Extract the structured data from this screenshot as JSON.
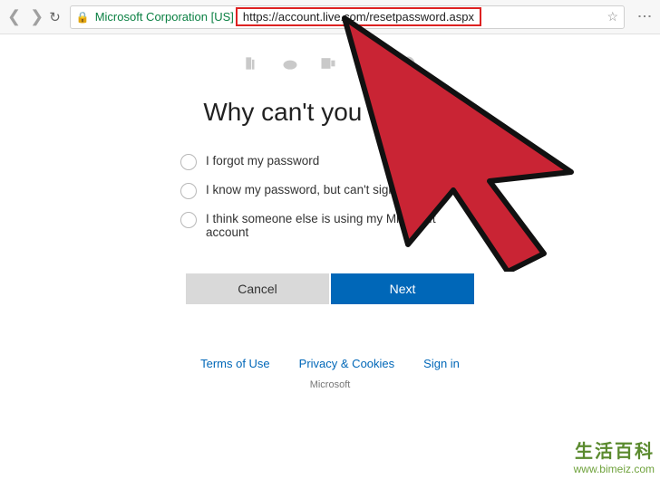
{
  "chrome": {
    "org_label": "Microsoft Corporation [US]",
    "url": "https://account.live.com/resetpassword.aspx"
  },
  "page": {
    "heading": "Why can't you sign in?",
    "options": [
      "I forgot my password",
      "I know my password, but can't sign in",
      "I think someone else is using my Microsoft account"
    ],
    "cancel_label": "Cancel",
    "next_label": "Next"
  },
  "footer": {
    "terms": "Terms of Use",
    "privacy": "Privacy & Cookies",
    "signin": "Sign in",
    "brand": "Microsoft"
  },
  "watermark": {
    "cn": "生活百科",
    "url": "www.bimeiz.com"
  }
}
